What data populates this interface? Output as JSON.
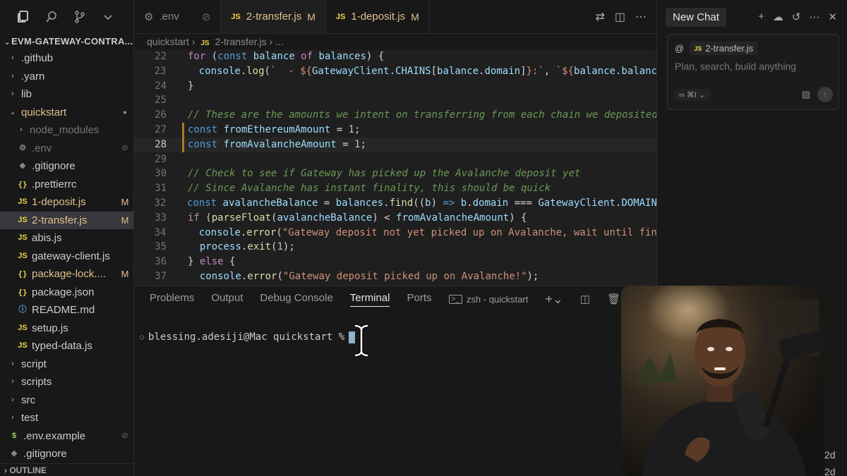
{
  "explorer": {
    "title": "EVM-GATEWAY-CONTRA...",
    "items": [
      {
        "label": ".github",
        "kind": "folder",
        "open": false,
        "indent": 0
      },
      {
        "label": ".yarn",
        "kind": "folder",
        "open": false,
        "indent": 0
      },
      {
        "label": "lib",
        "kind": "folder",
        "open": false,
        "indent": 0
      },
      {
        "label": "quickstart",
        "kind": "folder",
        "open": true,
        "indent": 0,
        "modified": true
      },
      {
        "label": "node_modules",
        "kind": "folder",
        "open": false,
        "indent": 1,
        "dim": true
      },
      {
        "label": ".env",
        "kind": "gear",
        "indent": 1,
        "dim": true,
        "ignored": true
      },
      {
        "label": ".gitignore",
        "kind": "git",
        "indent": 1
      },
      {
        "label": ".prettierrc",
        "kind": "json",
        "indent": 1
      },
      {
        "label": "1-deposit.js",
        "kind": "js",
        "indent": 1,
        "badge": "M"
      },
      {
        "label": "2-transfer.js",
        "kind": "js",
        "indent": 1,
        "badge": "M",
        "active": true
      },
      {
        "label": "abis.js",
        "kind": "js",
        "indent": 1
      },
      {
        "label": "gateway-client.js",
        "kind": "js",
        "indent": 1
      },
      {
        "label": "package-lock....",
        "kind": "json",
        "indent": 1,
        "badge": "M"
      },
      {
        "label": "package.json",
        "kind": "json",
        "indent": 1
      },
      {
        "label": "README.md",
        "kind": "info",
        "indent": 1
      },
      {
        "label": "setup.js",
        "kind": "js",
        "indent": 1
      },
      {
        "label": "typed-data.js",
        "kind": "js",
        "indent": 1
      },
      {
        "label": "script",
        "kind": "folder",
        "open": false,
        "indent": 0
      },
      {
        "label": "scripts",
        "kind": "folder",
        "open": false,
        "indent": 0
      },
      {
        "label": "src",
        "kind": "folder",
        "open": false,
        "indent": 0
      },
      {
        "label": "test",
        "kind": "folder",
        "open": false,
        "indent": 0
      },
      {
        "label": ".env.example",
        "kind": "dollar",
        "indent": 0,
        "ignored": true
      },
      {
        "label": ".gitignore",
        "kind": "git",
        "indent": 0
      }
    ],
    "outline_label": "OUTLINE"
  },
  "tabs": [
    {
      "label": ".env",
      "type": "gear",
      "active": false
    },
    {
      "label": "2-transfer.js",
      "type": "js",
      "badge": "M",
      "active": true
    },
    {
      "label": "1-deposit.js",
      "type": "js",
      "badge": "M",
      "active": false
    }
  ],
  "breadcrumb": {
    "folder": "quickstart",
    "file": "2-transfer.js",
    "more": "..."
  },
  "code": {
    "current_line": 28,
    "lines": [
      {
        "n": 22,
        "segs": [
          [
            "kw2",
            "for"
          ],
          [
            "op",
            " ("
          ],
          [
            "kw",
            "const"
          ],
          [
            "vr",
            " balance"
          ],
          [
            "kw2",
            " of"
          ],
          [
            "vr",
            " balances"
          ],
          [
            "op",
            ") {"
          ]
        ]
      },
      {
        "n": 23,
        "segs": [
          [
            "op",
            "  "
          ],
          [
            "vr",
            "console"
          ],
          [
            "op",
            "."
          ],
          [
            "fn",
            "log"
          ],
          [
            "op",
            "("
          ],
          [
            "str",
            "`  - ${"
          ],
          [
            "vr",
            "GatewayClient"
          ],
          [
            "op",
            "."
          ],
          [
            "vr",
            "CHAINS"
          ],
          [
            "op",
            "["
          ],
          [
            "vr",
            "balance"
          ],
          [
            "op",
            "."
          ],
          [
            "vr",
            "domain"
          ],
          [
            "op",
            "]"
          ],
          [
            "str",
            "}:`"
          ],
          [
            "op",
            ", "
          ],
          [
            "str",
            "`${"
          ],
          [
            "vr",
            "balance"
          ],
          [
            "op",
            "."
          ],
          [
            "vr",
            "balance"
          ]
        ]
      },
      {
        "n": 24,
        "segs": [
          [
            "op",
            "}"
          ]
        ]
      },
      {
        "n": 25,
        "segs": []
      },
      {
        "n": 26,
        "segs": [
          [
            "cm",
            "// These are the amounts we intent on transferring from each chain we deposited"
          ]
        ]
      },
      {
        "n": 27,
        "segs": [
          [
            "kw",
            "const"
          ],
          [
            "vr",
            " fromEthereumAmount"
          ],
          [
            "op",
            " = "
          ],
          [
            "num",
            "1"
          ],
          [
            "op",
            ";"
          ]
        ],
        "mod": true
      },
      {
        "n": 28,
        "segs": [
          [
            "kw",
            "const"
          ],
          [
            "vr",
            " fromAvalancheAmount"
          ],
          [
            "op",
            " = "
          ],
          [
            "num",
            "1"
          ],
          [
            "op",
            ";"
          ]
        ],
        "mod": true
      },
      {
        "n": 29,
        "segs": []
      },
      {
        "n": 30,
        "segs": [
          [
            "cm",
            "// Check to see if Gateway has picked up the Avalanche deposit yet"
          ]
        ]
      },
      {
        "n": 31,
        "segs": [
          [
            "cm",
            "// Since Avalanche has instant finality, this should be quick"
          ]
        ]
      },
      {
        "n": 32,
        "segs": [
          [
            "kw",
            "const"
          ],
          [
            "vr",
            " avalancheBalance"
          ],
          [
            "op",
            " = "
          ],
          [
            "vr",
            "balances"
          ],
          [
            "op",
            "."
          ],
          [
            "fn",
            "find"
          ],
          [
            "op",
            "(("
          ],
          [
            "vr",
            "b"
          ],
          [
            "op",
            ") "
          ],
          [
            "kw",
            "=>"
          ],
          [
            "vr",
            " b"
          ],
          [
            "op",
            "."
          ],
          [
            "vr",
            "domain"
          ],
          [
            "op",
            " === "
          ],
          [
            "vr",
            "GatewayClient"
          ],
          [
            "op",
            "."
          ],
          [
            "vr",
            "DOMAINS"
          ]
        ]
      },
      {
        "n": 33,
        "segs": [
          [
            "kw2",
            "if"
          ],
          [
            "op",
            " ("
          ],
          [
            "fn",
            "parseFloat"
          ],
          [
            "op",
            "("
          ],
          [
            "vr",
            "avalancheBalance"
          ],
          [
            "op",
            ") < "
          ],
          [
            "vr",
            "fromAvalancheAmount"
          ],
          [
            "op",
            ") {"
          ]
        ]
      },
      {
        "n": 34,
        "segs": [
          [
            "op",
            "  "
          ],
          [
            "vr",
            "console"
          ],
          [
            "op",
            "."
          ],
          [
            "fn",
            "error"
          ],
          [
            "op",
            "("
          ],
          [
            "str",
            "\"Gateway deposit not yet picked up on Avalanche, wait until fina"
          ]
        ]
      },
      {
        "n": 35,
        "segs": [
          [
            "op",
            "  "
          ],
          [
            "vr",
            "process"
          ],
          [
            "op",
            "."
          ],
          [
            "fn",
            "exit"
          ],
          [
            "op",
            "("
          ],
          [
            "num",
            "1"
          ],
          [
            "op",
            ");"
          ]
        ]
      },
      {
        "n": 36,
        "segs": [
          [
            "op",
            "} "
          ],
          [
            "kw2",
            "else"
          ],
          [
            "op",
            " {"
          ]
        ]
      },
      {
        "n": 37,
        "segs": [
          [
            "op",
            "  "
          ],
          [
            "vr",
            "console"
          ],
          [
            "op",
            "."
          ],
          [
            "fn",
            "error"
          ],
          [
            "op",
            "("
          ],
          [
            "str",
            "\"Gateway deposit picked up on Avalanche!\""
          ],
          [
            "op",
            ");"
          ]
        ]
      }
    ]
  },
  "panel": {
    "tabs": [
      "Problems",
      "Output",
      "Debug Console",
      "Terminal",
      "Ports"
    ],
    "active_tab": "Terminal",
    "terminal_name": "zsh - quickstart",
    "prompt": "blessing.adesiji@Mac quickstart %"
  },
  "chat": {
    "title": "New Chat",
    "context_at": "@",
    "context_file": "2-transfer.js",
    "placeholder": "Plan, search, build anything",
    "mode_label": "∞ ⌘I ⌄"
  },
  "right_strip": {
    "top_label": "2d",
    "bottom_label": "2d"
  },
  "colors": {
    "accent_modified": "#e2c08d",
    "js_icon": "#e8d44d",
    "editor_bg": "#1f1f1f",
    "sidebar_bg": "#181818"
  }
}
